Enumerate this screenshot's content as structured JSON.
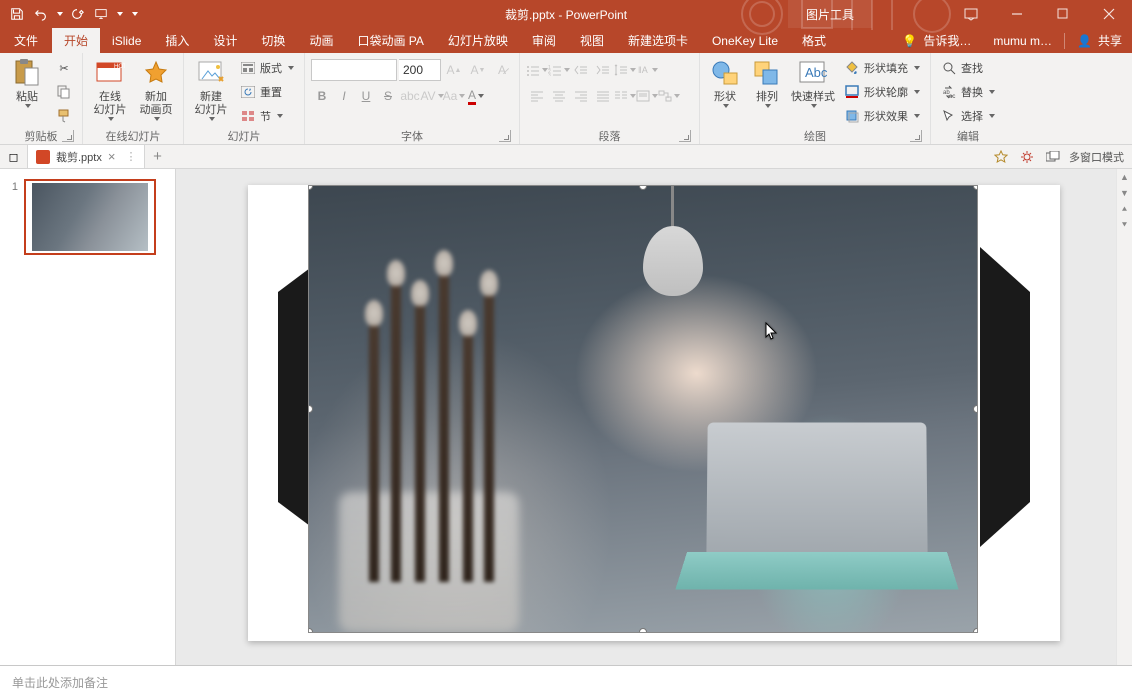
{
  "title": "裁剪.pptx - PowerPoint",
  "contextTab": "图片工具",
  "tabs": {
    "file": "文件",
    "home": "开始",
    "islide": "iSlide",
    "insert": "插入",
    "design": "设计",
    "transitions": "切换",
    "animations": "动画",
    "pocket": "口袋动画 PA",
    "slideshow": "幻灯片放映",
    "review": "审阅",
    "view": "视图",
    "newtab": "新建选项卡",
    "onekey": "OneKey Lite",
    "format": "格式",
    "tellme": "告诉我…",
    "user": "mumu m…",
    "share": "共享"
  },
  "ribbon": {
    "clipboard": {
      "label": "剪贴板",
      "paste": "粘贴"
    },
    "onlineslides": {
      "label": "在线幻灯片",
      "online": "在线\n幻灯片",
      "newanim": "新加\n动画页"
    },
    "slides": {
      "label": "幻灯片",
      "newslide": "新建\n幻灯片",
      "layout": "版式",
      "reset": "重置",
      "section": "节"
    },
    "font": {
      "label": "字体",
      "size": "200"
    },
    "paragraph": {
      "label": "段落"
    },
    "drawing": {
      "label": "绘图",
      "shapes": "形状",
      "arrange": "排列",
      "quickstyle": "快速样式",
      "fill": "形状填充",
      "outline": "形状轮廓",
      "effects": "形状效果"
    },
    "editing": {
      "label": "编辑",
      "find": "查找",
      "replace": "替换",
      "select": "选择"
    }
  },
  "docTab": {
    "name": "裁剪.pptx"
  },
  "multiwindow": "多窗口模式",
  "thumb": {
    "num": "1"
  },
  "notes": "单击此处添加备注"
}
